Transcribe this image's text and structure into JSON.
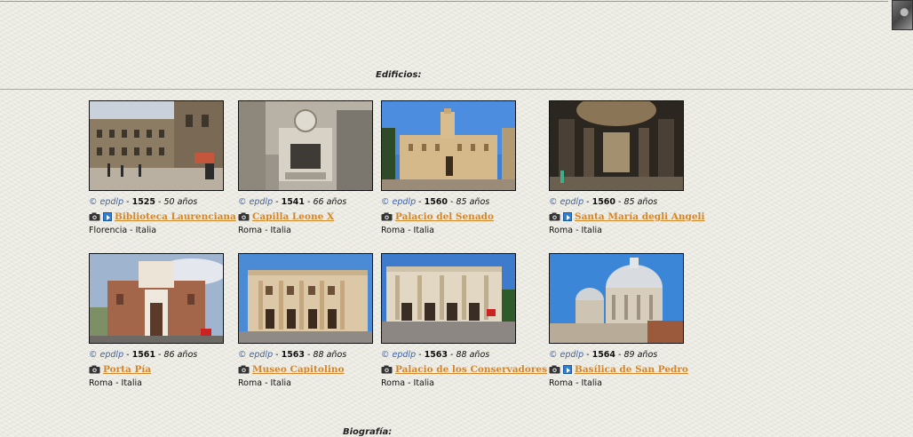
{
  "sections": {
    "edificios_heading": "Edificios:",
    "biografia_heading": "Biografía:"
  },
  "sep": " - ",
  "buildings": [
    {
      "credit": "© epdlp",
      "year": "1525",
      "age": "50 años",
      "title": "Biblioteca Laurenciana",
      "place": "Florencia - Italia",
      "has_video": true,
      "photo_icon": "library-photo"
    },
    {
      "credit": "© epdlp",
      "year": "1541",
      "age": "66 años",
      "title": "Capilla Leone X",
      "place": "Roma - Italia",
      "has_video": false,
      "photo_icon": "chapel-photo"
    },
    {
      "credit": "© epdlp",
      "year": "1560",
      "age": "85 años",
      "title": "Palacio del Senado",
      "place": "Roma - Italia",
      "has_video": false,
      "photo_icon": "senate-photo"
    },
    {
      "credit": "© epdlp",
      "year": "1560",
      "age": "85 años",
      "title": "Santa María degli Angeli",
      "place": "Roma - Italia",
      "has_video": true,
      "photo_icon": "church-interior-photo"
    },
    {
      "credit": "© epdlp",
      "year": "1561",
      "age": "86 años",
      "title": "Porta Pía",
      "place": "Roma - Italia",
      "has_video": false,
      "photo_icon": "gate-photo"
    },
    {
      "credit": "© epdlp",
      "year": "1563",
      "age": "88 años",
      "title": "Museo Capitolino",
      "place": "Roma - Italia",
      "has_video": false,
      "photo_icon": "museum-photo"
    },
    {
      "credit": "© epdlp",
      "year": "1563",
      "age": "88 años",
      "title": "Palacio de los Conservadores",
      "place": "Roma - Italia",
      "has_video": false,
      "photo_icon": "conservatori-photo"
    },
    {
      "credit": "© epdlp",
      "year": "1564",
      "age": "89 años",
      "title": "Basílica de San Pedro",
      "place": "Roma - Italia",
      "has_video": true,
      "photo_icon": "basilica-photo"
    }
  ],
  "colors": {
    "link": "#d4862a",
    "credit": "#3d62a8",
    "video_badge": "#2a7fd6"
  }
}
